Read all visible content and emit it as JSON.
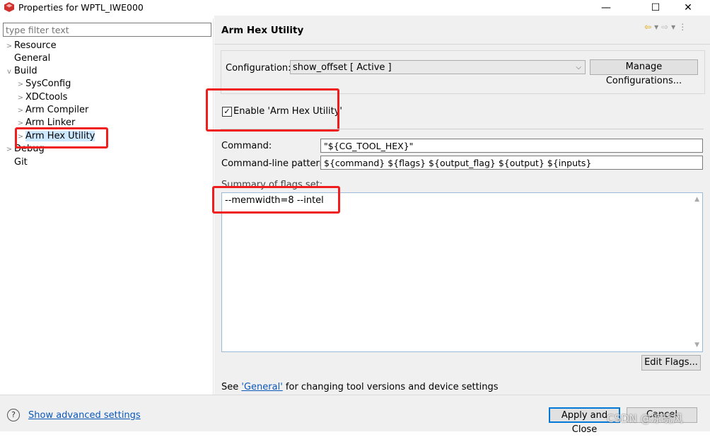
{
  "window": {
    "title": "Properties for WPTL_IWE000",
    "minimize": "—",
    "maximize": "☐",
    "close": "✕"
  },
  "filter": {
    "placeholder": "type filter text"
  },
  "tree": {
    "resource": "Resource",
    "general": "General",
    "build": "Build",
    "sysconfig": "SysConfig",
    "xdctools": "XDCtools",
    "arm_compiler": "Arm Compiler",
    "arm_linker": "Arm Linker",
    "arm_hex_utility": "Arm Hex Utility",
    "debug": "Debug",
    "git": "Git"
  },
  "page": {
    "title": "Arm Hex Utility",
    "configuration_label": "Configuration:",
    "configuration_value": "show_offset  [ Active ]",
    "manage_configurations": "Manage Configurations...",
    "enable_label": "Enable 'Arm Hex Utility'",
    "enable_checked": true,
    "command_label": "Command:",
    "command_value": "\"${CG_TOOL_HEX}\"",
    "pattern_label": "Command-line pattern:",
    "pattern_value": "${command} ${flags} ${output_flag} ${output} ${inputs}",
    "summary_label": "Summary of flags set:",
    "summary_value": "--memwidth=8 --intel",
    "edit_flags": "Edit Flags...",
    "see_text": "See",
    "general_link": "'General'",
    "see_rest": "for changing tool versions and device settings"
  },
  "footer": {
    "help": "?",
    "show_advanced": "Show advanced settings",
    "apply_close": "Apply and Close",
    "cancel": "Cancel",
    "watermark": "CSDN @凉晓风"
  },
  "colors": {
    "highlight_box": "#ef1d1d",
    "link": "#0b58b8",
    "selection": "#cce8ff"
  }
}
